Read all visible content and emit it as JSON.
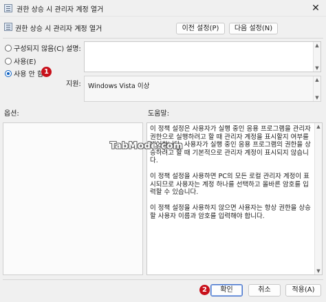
{
  "window": {
    "title": "권한 상승 시 관리자 계정 열거",
    "close_glyph": "✕"
  },
  "header": {
    "title": "권한 상승 시 관리자 계정 열거",
    "prev_button": "이전 설정(P)",
    "next_button": "다음 설정(N)"
  },
  "radios": [
    {
      "label": "구성되지 않음(C)",
      "checked": false
    },
    {
      "label": "사용(E)",
      "checked": false
    },
    {
      "label": "사용 안 함",
      "checked": true
    }
  ],
  "badges": {
    "first": "1",
    "second": "2"
  },
  "comment_label": "설명:",
  "supported_label": "지원:",
  "supported_value": "Windows Vista 이상",
  "options_label": "옵션:",
  "help_label": "도움말:",
  "help_text": "이 정책 설정은 사용자가 실행 중인 응용 프로그램을 관리자 권한으로 실행하려고 할 때 관리자 계정을 표시할지 여부를 제어합니다. 사용자가 실행 중인 응용 프로그램의 권한을 상승하려고 할 때 기본적으로 관리자 계정이 표시되지 않습니다.\n\n이 정책 설정을 사용하면 PC의 모든 로컬 관리자 계정이 표시되므로 사용자는 계정 하나를 선택하고 올바른 암호를 입력할 수 있습니다.\n\n이 정책 설정을 사용하지 않으면 사용자는 항상 권한을 상승할 사용자 이름과 암호를 입력해야 합니다.",
  "watermark": "TabMode.com",
  "buttons": {
    "ok": "확인",
    "cancel": "취소",
    "apply": "적용(A)"
  },
  "colors": {
    "badge": "#c8101a",
    "accent": "#0a5fc2"
  }
}
